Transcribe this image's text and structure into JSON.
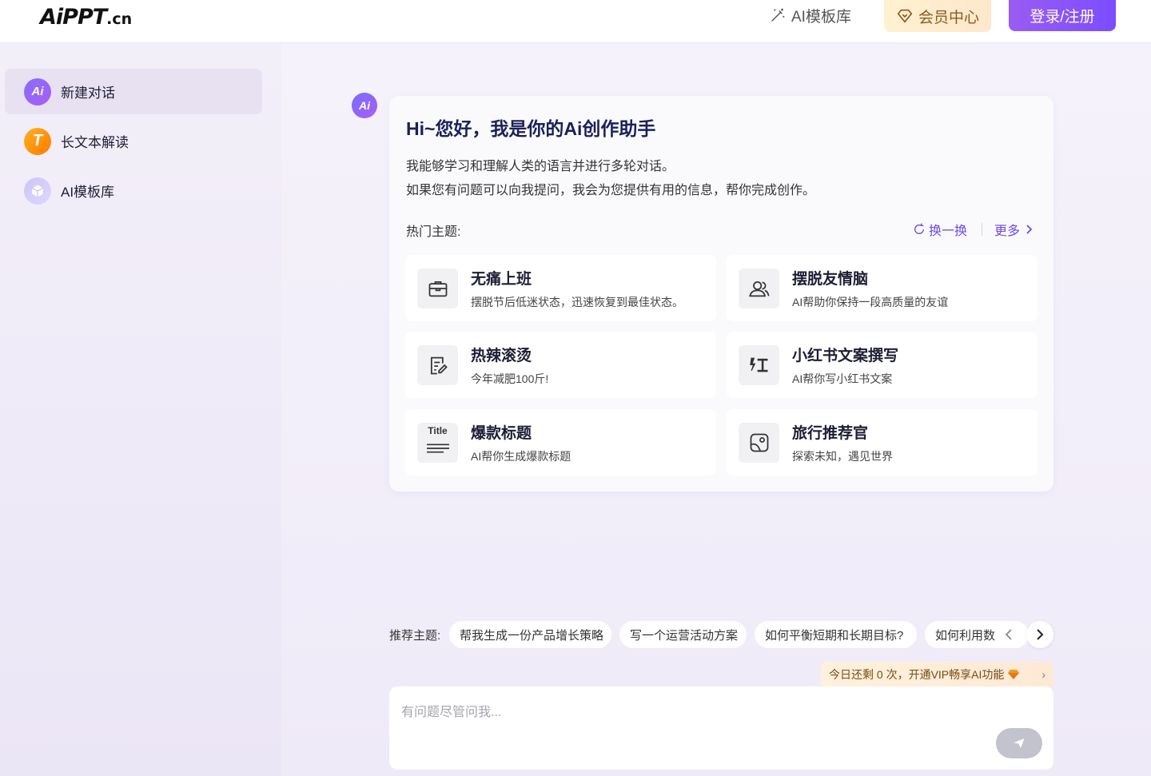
{
  "header": {
    "logo_main": "AiPPT",
    "logo_suffix": ".cn",
    "nav_templates": "AI模板库",
    "vip_label": "会员中心",
    "login_label": "登录/注册"
  },
  "sidebar": {
    "items": [
      {
        "label": "新建对话",
        "icon": "ai-logo-icon",
        "active": true
      },
      {
        "label": "长文本解读",
        "icon": "long-text-icon"
      },
      {
        "label": "AI模板库",
        "icon": "template-box-icon"
      }
    ]
  },
  "chat": {
    "avatar_text": "Ai",
    "greeting_title": "Hi~您好，我是你的Ai创作助手",
    "greeting_line1": "我能够学习和理解人类的语言并进行多轮对话。",
    "greeting_line2": "如果您有问题可以向我提问，我会为您提供有用的信息，帮你完成创作。",
    "hot_label": "热门主题:",
    "refresh_label": "换一换",
    "more_label": "更多",
    "topics": [
      {
        "title": "无痛上班",
        "sub": "摆脱节后低迷状态，迅速恢复到最佳状态。",
        "icon": "briefcase-icon"
      },
      {
        "title": "摆脱友情脑",
        "sub": "AI帮助你保持一段高质量的友谊",
        "icon": "people-icon"
      },
      {
        "title": "热辣滚烫",
        "sub": "今年减肥100斤!",
        "icon": "document-edit-icon"
      },
      {
        "title": "小红书文案撰写",
        "sub": "AI帮你写小红书文案",
        "icon": "red-note-icon"
      },
      {
        "title": "爆款标题",
        "sub": "AI帮你生成爆款标题",
        "icon": "title-icon",
        "icon_text": "Title"
      },
      {
        "title": "旅行推荐官",
        "sub": "探索未知，遇见世界",
        "icon": "map-icon"
      }
    ]
  },
  "recommend": {
    "label": "推荐主题:",
    "chips": [
      "帮我生成一份产品增长策略",
      "写一个运营活动方案",
      "如何平衡短期和长期目标?",
      "如何利用数"
    ]
  },
  "quota": {
    "text": "今日还剩 0 次，开通VIP畅享AI功能"
  },
  "input": {
    "placeholder": "有问题尽管问我..."
  },
  "colors": {
    "accent": "#7048e8",
    "login_gradient_start": "#9a5cf2",
    "login_gradient_end": "#7c4dff",
    "vip_text": "#8a5a1c"
  }
}
